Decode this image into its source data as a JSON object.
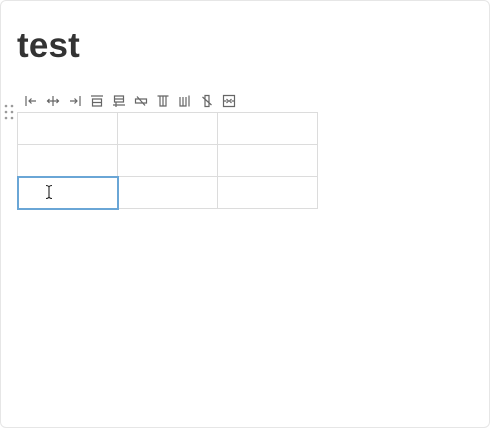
{
  "page": {
    "title": "test"
  },
  "toolbar": {
    "buttons": [
      {
        "name": "insert-column-left-button",
        "icon": "column-insert-left-icon"
      },
      {
        "name": "insert-column-between-button",
        "icon": "column-insert-middle-icon"
      },
      {
        "name": "insert-column-right-button",
        "icon": "column-insert-right-icon"
      },
      {
        "name": "insert-row-above-button",
        "icon": "row-insert-above-icon"
      },
      {
        "name": "insert-row-below-button",
        "icon": "row-insert-below-icon"
      },
      {
        "name": "delete-row-button",
        "icon": "row-delete-icon"
      },
      {
        "name": "insert-column-before-button",
        "icon": "column-add-before-icon"
      },
      {
        "name": "insert-column-after-button",
        "icon": "column-add-after-icon"
      },
      {
        "name": "delete-column-button",
        "icon": "column-delete-icon"
      },
      {
        "name": "merge-cells-button",
        "icon": "merge-cells-icon"
      }
    ]
  },
  "table": {
    "rows": [
      [
        "",
        "",
        ""
      ],
      [
        "",
        "",
        ""
      ],
      [
        "",
        "",
        ""
      ]
    ],
    "active_cell": {
      "row": 3,
      "column": 1
    }
  },
  "colors": {
    "title": "#333333",
    "icon": "#666666",
    "cell_border": "#dcdcdc",
    "active_cell_border": "#6aa6d6"
  }
}
